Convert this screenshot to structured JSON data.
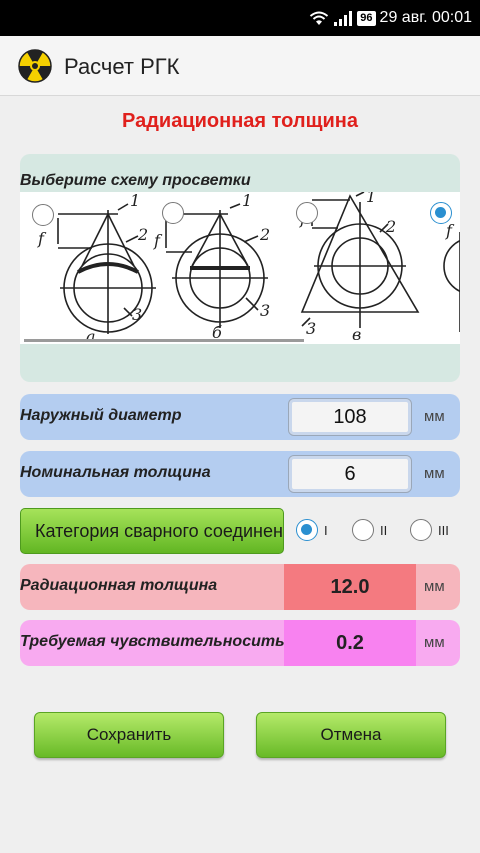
{
  "status_bar": {
    "battery": "96",
    "datetime": "29 авг. 00:01"
  },
  "app": {
    "title": "Расчет РГК"
  },
  "page": {
    "heading": "Радиационная толщина"
  },
  "scheme": {
    "label": "Выберите схему просветки",
    "options": [
      {
        "selected": false,
        "caption": "а"
      },
      {
        "selected": false,
        "caption": "б"
      },
      {
        "selected": false,
        "caption": "в"
      },
      {
        "selected": true,
        "caption": ""
      }
    ],
    "drawing_labels": {
      "f": "f",
      "n1": "1",
      "n2": "2",
      "n3": "3"
    }
  },
  "outer_diameter": {
    "label": "Наружный диаметр",
    "value": "108",
    "unit": "мм"
  },
  "nominal_thickness": {
    "label": "Номинальная толщина",
    "value": "6",
    "unit": "мм"
  },
  "weld_category": {
    "button_label": "Категория сварного соединения",
    "options": [
      {
        "label": "I",
        "selected": true
      },
      {
        "label": "II",
        "selected": false
      },
      {
        "label": "III",
        "selected": false
      }
    ]
  },
  "radiation_thickness": {
    "label": "Радиационная толщина",
    "value": "12.0",
    "unit": "мм"
  },
  "required_sensitivity": {
    "label": "Требуемая чувствительносить",
    "value": "0.2",
    "unit": "мм"
  },
  "buttons": {
    "save": "Сохранить",
    "cancel": "Отмена"
  },
  "colors": {
    "heading": "#e0201c",
    "accent": "#2a8fd0",
    "button_green": "#68ba27",
    "row_blue": "#b4cdf0",
    "row_red": "#f6b6bd",
    "row_pink": "#f8aaf0"
  }
}
